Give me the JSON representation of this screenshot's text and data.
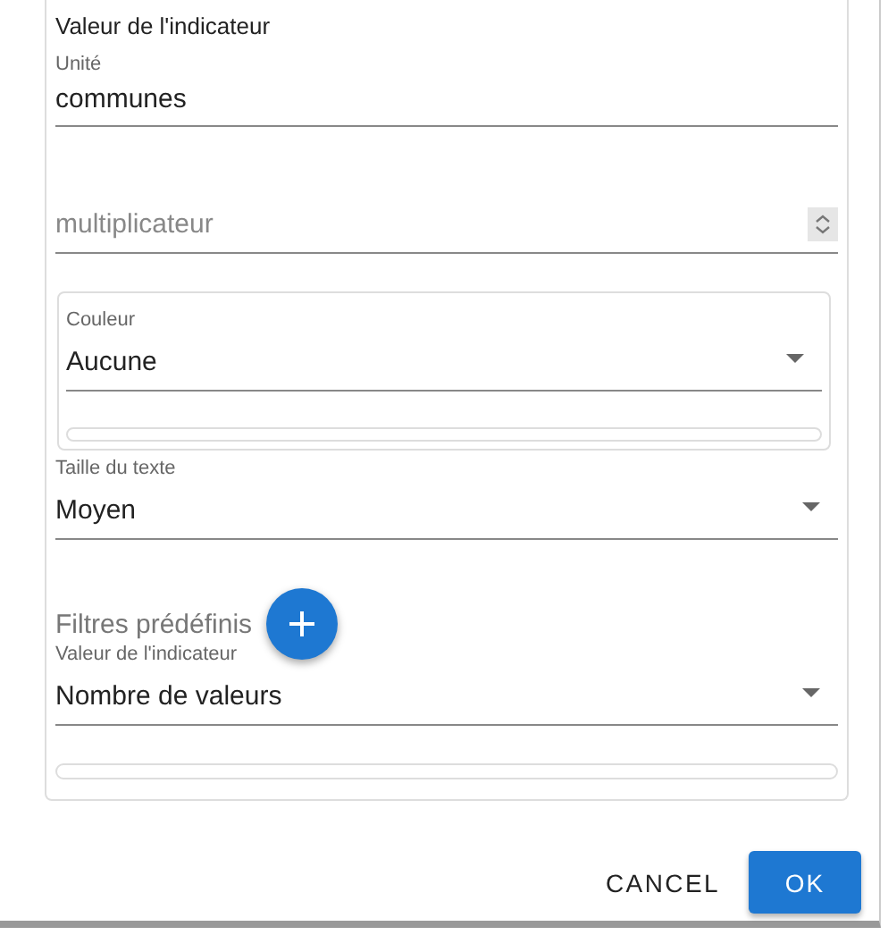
{
  "panel": {
    "title": "Valeur de l'indicateur",
    "fields": [
      {
        "kind": "text",
        "label": "Unité",
        "value": "communes"
      },
      {
        "kind": "number",
        "placeholder": "multiplicateur"
      },
      {
        "kind": "boxed-select",
        "label": "Couleur",
        "value": "Aucune"
      },
      {
        "kind": "select",
        "label": "Taille du texte",
        "value": "Moyen"
      },
      {
        "kind": "heading",
        "text": "Filtres prédéfinis"
      },
      {
        "kind": "select-bar",
        "label": "Valeur de l'indicateur",
        "value": "Nombre de valeurs"
      }
    ]
  },
  "buttons": [
    {
      "kind": "text",
      "label": "CANCEL"
    },
    {
      "kind": "primary",
      "label": "OK"
    }
  ]
}
